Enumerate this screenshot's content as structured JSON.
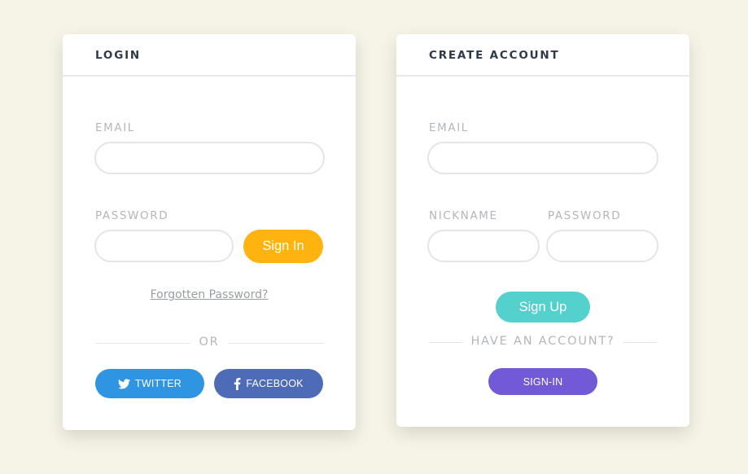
{
  "colors": {
    "background": "#f6f4e6",
    "sign_in": "#ffb30f",
    "twitter": "#2f95e3",
    "facebook": "#4e6bb8",
    "sign_up": "#54d1cd",
    "sign_in_alt": "#7259d6"
  },
  "login": {
    "title": "LOGIN",
    "email_label": "EMAIL",
    "email_value": "",
    "password_label": "PASSWORD",
    "password_value": "",
    "sign_in_label": "Sign In",
    "forgot_label": "Forgotten Password?",
    "or_label": "OR",
    "twitter_label": "TWITTER",
    "twitter_icon": "twitter-bird-icon",
    "facebook_label": "FACEBOOK",
    "facebook_icon": "facebook-f-icon"
  },
  "signup": {
    "title": "CREATE ACCOUNT",
    "email_label": "EMAIL",
    "email_value": "",
    "nickname_label": "NICKNAME",
    "nickname_value": "",
    "password_label": "PASSWORD",
    "password_value": "",
    "sign_up_label": "Sign Up",
    "have_account_label": "HAVE AN ACCOUNT?",
    "sign_in_label": "SIGN-IN"
  }
}
